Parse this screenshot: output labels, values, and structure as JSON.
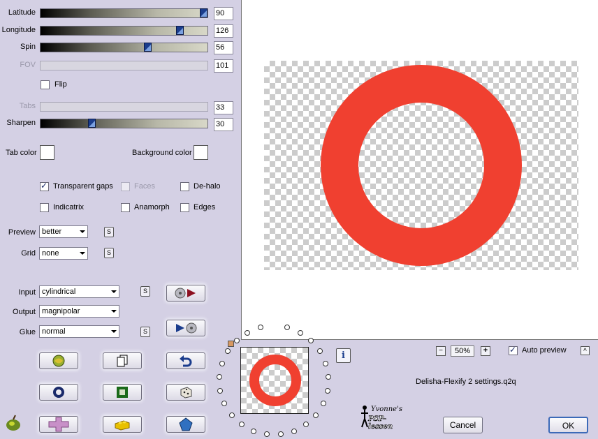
{
  "sliders": {
    "latitude": {
      "label": "Latitude",
      "value": "90",
      "level": 1.0
    },
    "longitude": {
      "label": "Longitude",
      "value": "126",
      "level": 0.85
    },
    "spin": {
      "label": "Spin",
      "value": "56",
      "level": 0.65
    },
    "fov": {
      "label": "FOV",
      "value": "101"
    },
    "tabs": {
      "label": "Tabs",
      "value": "33"
    },
    "sharpen": {
      "label": "Sharpen",
      "value": "30",
      "level": 0.3
    }
  },
  "flip": {
    "label": "Flip",
    "checked": false
  },
  "colors": {
    "tab_label": "Tab color",
    "background_label": "Background color",
    "tab": "#ffffff",
    "background": "#ffffff"
  },
  "options": {
    "transparent_gaps": {
      "label": "Transparent gaps",
      "checked": true
    },
    "faces": {
      "label": "Faces",
      "checked": false
    },
    "dehalo": {
      "label": "De-halo",
      "checked": false
    },
    "indicatrix": {
      "label": "Indicatrix",
      "checked": false
    },
    "anamorph": {
      "label": "Anamorph",
      "checked": false
    },
    "edges": {
      "label": "Edges",
      "checked": false
    }
  },
  "preview_sel": {
    "label": "Preview",
    "value": "better"
  },
  "grid_sel": {
    "label": "Grid",
    "value": "none"
  },
  "input_sel": {
    "label": "Input",
    "value": "cylindrical"
  },
  "output_sel": {
    "label": "Output",
    "value": "magnipolar"
  },
  "glue_sel": {
    "label": "Glue",
    "value": "normal"
  },
  "s_label": "S",
  "zoom": {
    "value": "50%",
    "minus": "−",
    "plus": "+"
  },
  "auto_preview": {
    "label": "Auto preview",
    "checked": true
  },
  "collapse_btn": "^",
  "info_btn": "i",
  "settings_file": "Delisha-Flexify 2 settings.q2q",
  "logo": {
    "line1": "Yvonne's",
    "line2": "PSP-lessen"
  },
  "buttons": {
    "cancel": "Cancel",
    "ok": "OK"
  },
  "colors_theme": {
    "ring": "#f04030",
    "panel": "#d4d0e4",
    "thumb": "#1a3c8c"
  }
}
